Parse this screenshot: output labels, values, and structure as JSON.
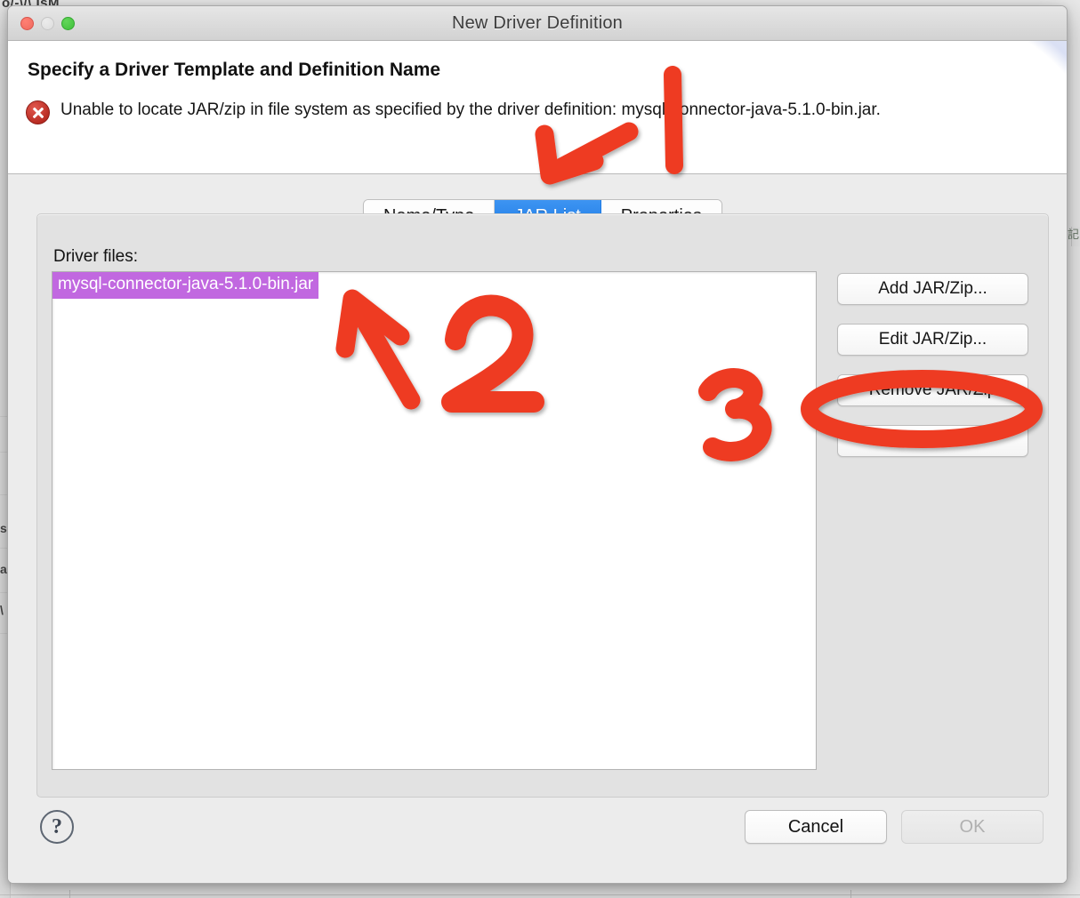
{
  "backdrop": {
    "top_text": "o/-\\/\\ IsM",
    "left_fragments": [
      "s",
      "a",
      "\\"
    ],
    "right_glyph": "記"
  },
  "window": {
    "title": "New Driver Definition",
    "traffic_lights": [
      "close-button",
      "minimize-button",
      "maximize-button"
    ]
  },
  "banner": {
    "title": "Specify a Driver Template and Definition Name",
    "status_icon": "error-icon",
    "message": "Unable to locate JAR/zip in file system as specified by the driver definition: mysql-connector-java-5.1.0-bin.jar."
  },
  "tabs": [
    {
      "label": "Name/Type",
      "selected": false
    },
    {
      "label": "JAR List",
      "selected": true
    },
    {
      "label": "Properties",
      "selected": false
    }
  ],
  "jar_list_panel": {
    "label": "Driver files:",
    "items": [
      {
        "name": "mysql-connector-java-5.1.0-bin.jar",
        "selected": true
      }
    ],
    "buttons": [
      {
        "label": "Add JAR/Zip...",
        "enabled": true
      },
      {
        "label": "Edit JAR/Zip...",
        "enabled": true
      },
      {
        "label": "Remove JAR/Zip",
        "enabled": true
      },
      {
        "label": "Clear All",
        "enabled": true
      }
    ]
  },
  "footer": {
    "help_label": "?",
    "cancel_label": "Cancel",
    "ok_label": "OK",
    "ok_enabled": false
  },
  "annotations": {
    "color": "#ee3b24",
    "marks": [
      {
        "id": "step-1-stroke",
        "kind": "digit",
        "label": "1"
      },
      {
        "id": "step-1-arrow",
        "kind": "arrow",
        "points_to": "tab-jar-list"
      },
      {
        "id": "step-2-arrow",
        "kind": "arrow",
        "points_to": "list-item-selected"
      },
      {
        "id": "step-2-digit",
        "kind": "digit",
        "label": "2"
      },
      {
        "id": "step-3-digit",
        "kind": "digit",
        "label": "3"
      },
      {
        "id": "step-3-circle",
        "kind": "ellipse",
        "points_to": "remove-jar-zip-button"
      }
    ]
  },
  "colors": {
    "accent_tab": "#2b82e8",
    "selection": "#c168e0",
    "annotation_red": "#ee3b24",
    "error_red": "#b82b22"
  }
}
